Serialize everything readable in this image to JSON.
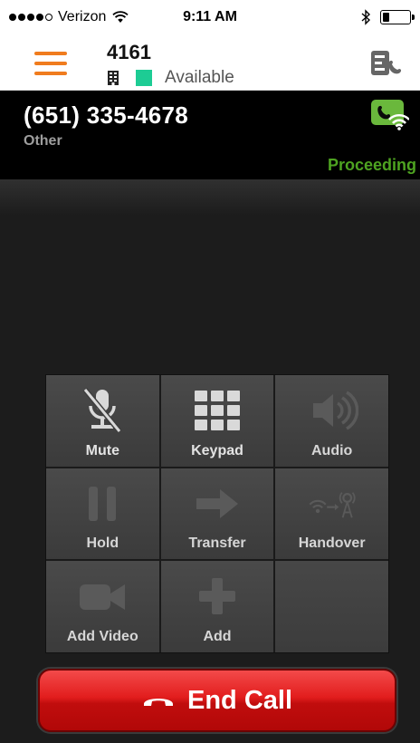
{
  "status_bar": {
    "carrier": "Verizon",
    "time": "9:11 AM",
    "signal_bars_filled": 4,
    "signal_bars_total": 5,
    "battery_level": 0.35
  },
  "header": {
    "extension": "4161",
    "presence": "Available",
    "presence_color": "#1dcc94",
    "menu_icon": "hamburger-menu-icon",
    "right_icon": "contacts-call-icon",
    "accent_color": "#f07c1e"
  },
  "call": {
    "number": "(651) 335-4678",
    "type": "Other",
    "status": "Proceeding",
    "status_color": "#4ea321",
    "network_icon": "wifi-call-icon"
  },
  "controls": [
    {
      "label": "Mute",
      "icon": "muted-microphone-icon",
      "enabled": true
    },
    {
      "label": "Keypad",
      "icon": "keypad-icon",
      "enabled": true
    },
    {
      "label": "Audio",
      "icon": "speaker-icon",
      "enabled": false
    },
    {
      "label": "Hold",
      "icon": "pause-icon",
      "enabled": false
    },
    {
      "label": "Transfer",
      "icon": "arrow-right-icon",
      "enabled": false
    },
    {
      "label": "Handover",
      "icon": "wifi-to-cell-tower-icon",
      "enabled": false
    },
    {
      "label": "Add Video",
      "icon": "video-camera-icon",
      "enabled": false
    },
    {
      "label": "Add",
      "icon": "plus-icon",
      "enabled": false
    }
  ],
  "end_call": {
    "label": "End Call",
    "icon": "hang-up-phone-icon",
    "color": "#e21d1d"
  }
}
